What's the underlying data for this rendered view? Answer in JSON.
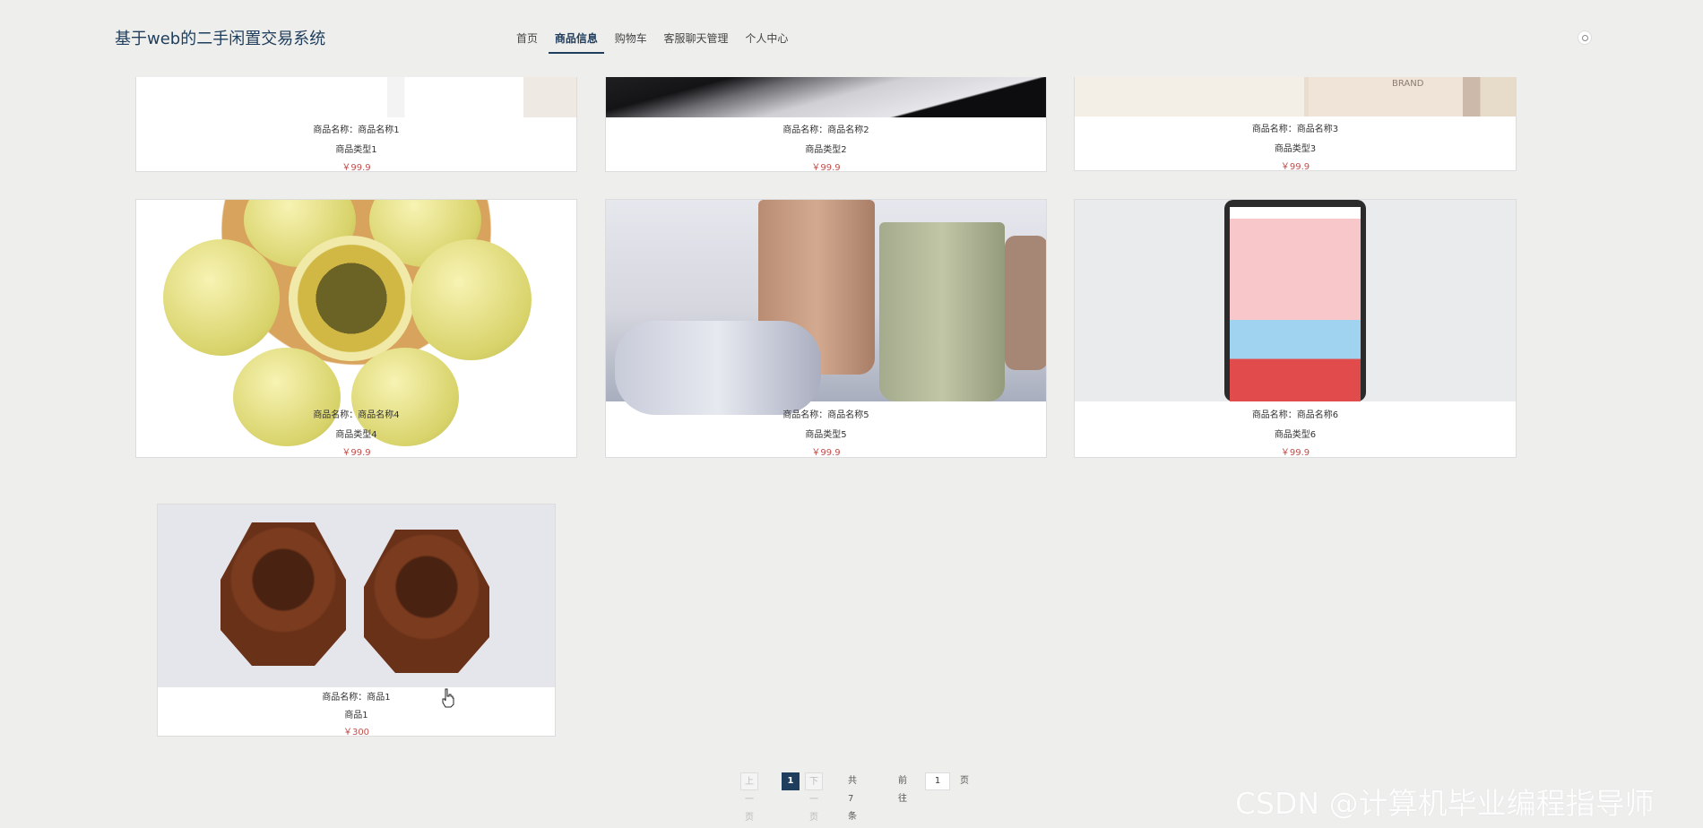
{
  "header": {
    "logo": "基于web的二手闲置交易系统",
    "nav": [
      {
        "label": "首页"
      },
      {
        "label": "商品信息",
        "active": true
      },
      {
        "label": "购物车"
      },
      {
        "label": "客服聊天管理"
      },
      {
        "label": "个人中心"
      }
    ]
  },
  "products": [
    {
      "name_line": "商品名称：商品名称1",
      "type": "商品类型1",
      "price": "￥99.9"
    },
    {
      "name_line": "商品名称：商品名称2",
      "type": "商品类型2",
      "price": "￥99.9"
    },
    {
      "name_line": "商品名称：商品名称3",
      "type": "商品类型3",
      "price": "￥99.9",
      "image_text": "BRAND"
    },
    {
      "name_line": "商品名称：商品名称4",
      "type": "商品类型4",
      "price": "￥99.9"
    },
    {
      "name_line": "商品名称：商品名称5",
      "type": "商品类型5",
      "price": "￥99.9"
    },
    {
      "name_line": "商品名称：商品名称6",
      "type": "商品类型6",
      "price": "￥99.9"
    },
    {
      "name_line": "商品名称：商品1",
      "type": "商品1",
      "price": "￥300"
    }
  ],
  "pagination": {
    "prev": "上一页",
    "current": "1",
    "next": "下一页",
    "total": "共 7 条",
    "goto_label": "前往",
    "goto_value": "1",
    "page_suffix": "页"
  },
  "watermark": "CSDN @计算机毕业编程指导师",
  "colors": {
    "primary": "#1f3d5c",
    "price": "#c0504d",
    "background": "#eeeeec"
  }
}
